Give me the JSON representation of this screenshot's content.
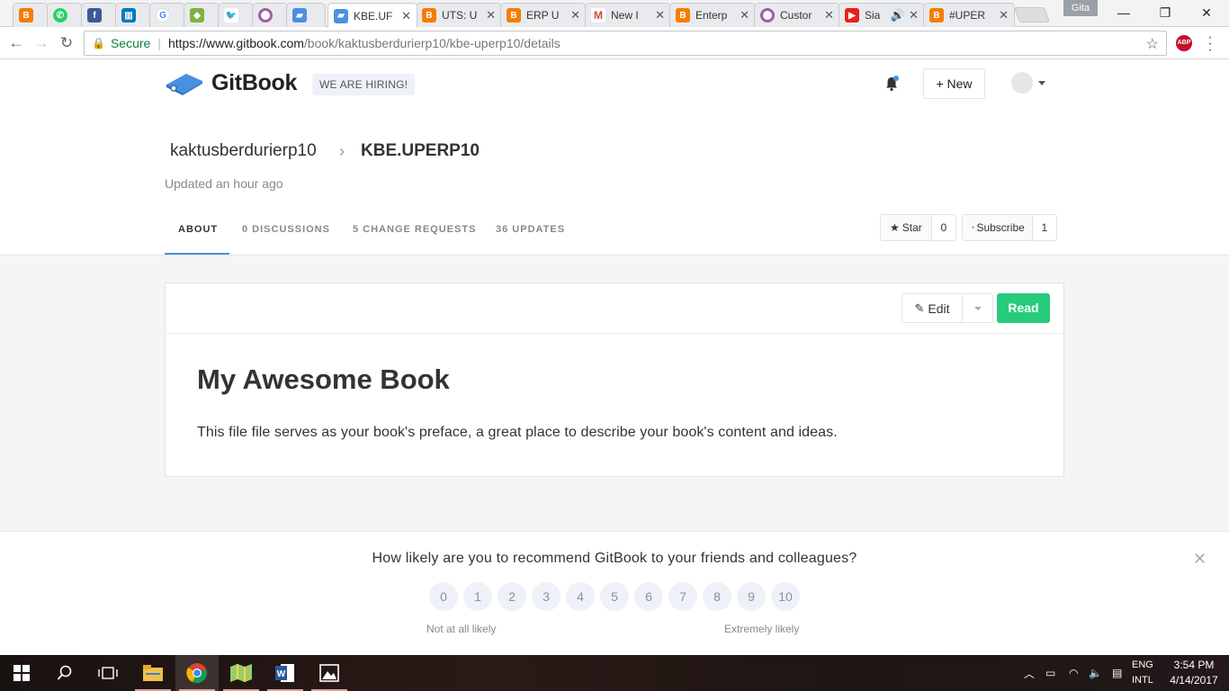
{
  "browser": {
    "tabs": [
      {
        "label": "",
        "icon": "blogger-icon",
        "color": "#f57d00"
      },
      {
        "label": "",
        "icon": "whatsapp-icon",
        "color": "#25d366"
      },
      {
        "label": "",
        "icon": "facebook-icon",
        "color": "#3b5998"
      },
      {
        "label": "",
        "icon": "trello-icon",
        "color": "#0079bf"
      },
      {
        "label": "",
        "icon": "google-icon",
        "color": "#4285f4"
      },
      {
        "label": "",
        "icon": "extension-icon",
        "color": "#7cb342"
      },
      {
        "label": "",
        "icon": "twitter-icon",
        "color": "#1da1f2"
      },
      {
        "label": "",
        "icon": "circle-icon",
        "color": "#a45ba6"
      },
      {
        "label": "",
        "icon": "gitbook-icon",
        "color": "#4a90e2"
      },
      {
        "label": "KBE.UF",
        "icon": "gitbook-icon",
        "color": "#4a90e2",
        "active": true
      },
      {
        "label": "UTS: U",
        "icon": "blogger-icon",
        "color": "#f57d00"
      },
      {
        "label": "ERP U",
        "icon": "blogger-icon",
        "color": "#f57d00"
      },
      {
        "label": "New I",
        "icon": "gmail-icon",
        "color": "#d44638"
      },
      {
        "label": "Enterp",
        "icon": "blogger-icon",
        "color": "#f57d00"
      },
      {
        "label": "Custor",
        "icon": "circle-icon",
        "color": "#a45ba6"
      },
      {
        "label": "Sia",
        "icon": "youtube-icon",
        "color": "#e62117"
      },
      {
        "label": "#UPER",
        "icon": "blogger-icon",
        "color": "#f57d00"
      }
    ],
    "profile_name": "Gita",
    "secure_label": "Secure",
    "url_host": "https://www.gitbook.com",
    "url_path": "/book/kaktusberdurierp10/kbe-uperp10/details",
    "abp_label": "ABP"
  },
  "header": {
    "brand": "GitBook",
    "hiring": "WE ARE HIRING!",
    "new_button": "New"
  },
  "book": {
    "owner": "kaktusberdurierp10",
    "name": "KBE.UPERP10",
    "updated": "Updated an hour ago"
  },
  "nav_tabs": [
    {
      "label": "ABOUT",
      "active": true
    },
    {
      "label": "0 DISCUSSIONS"
    },
    {
      "label": "5 CHANGE REQUESTS"
    },
    {
      "label": "36 UPDATES"
    }
  ],
  "actions": {
    "star_label": "Star",
    "star_count": "0",
    "subscribe_label": "Subscribe",
    "subscribe_count": "1",
    "edit_label": "Edit",
    "read_label": "Read"
  },
  "content": {
    "title": "My Awesome Book",
    "description": "This file file serves as your book's preface, a great place to describe your book's content and ideas."
  },
  "survey": {
    "question": "How likely are you to recommend GitBook to your friends and colleagues?",
    "scores": [
      "0",
      "1",
      "2",
      "3",
      "4",
      "5",
      "6",
      "7",
      "8",
      "9",
      "10"
    ],
    "low_label": "Not at all likely",
    "high_label": "Extremely likely"
  },
  "taskbar": {
    "lang_top": "ENG",
    "lang_bottom": "INTL",
    "time": "3:54 PM",
    "date": "4/14/2017"
  }
}
